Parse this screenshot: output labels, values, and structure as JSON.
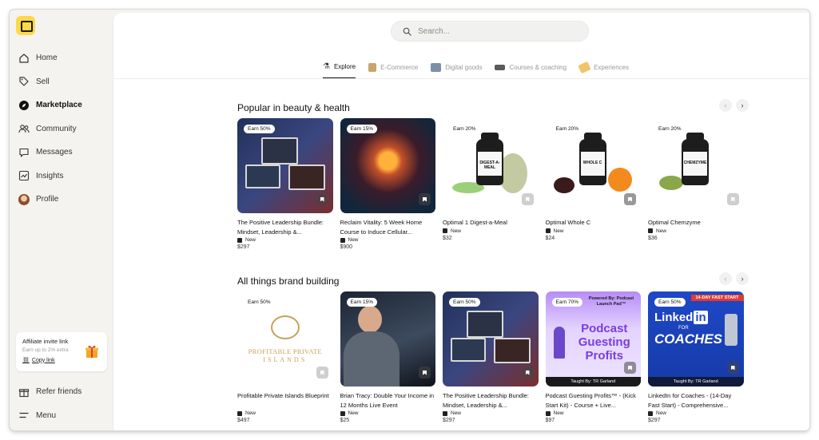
{
  "sidebar": {
    "items": [
      {
        "label": "Home",
        "icon": "home-icon"
      },
      {
        "label": "Sell",
        "icon": "tag-icon"
      },
      {
        "label": "Marketplace",
        "icon": "compass-icon",
        "active": true
      },
      {
        "label": "Community",
        "icon": "people-icon"
      },
      {
        "label": "Messages",
        "icon": "chat-icon"
      },
      {
        "label": "Insights",
        "icon": "chart-icon"
      },
      {
        "label": "Profile",
        "icon": "avatar"
      }
    ],
    "affiliate": {
      "title": "Affiliate invite link",
      "subtitle": "Earn up to 2% extra",
      "link": "Copy link"
    },
    "bottom": [
      {
        "label": "Refer friends",
        "icon": "gift-icon"
      },
      {
        "label": "Menu",
        "icon": "menu-icon"
      }
    ]
  },
  "search": {
    "placeholder": "Search..."
  },
  "tabs": [
    {
      "label": "Explore",
      "active": true
    },
    {
      "label": "E-Commerce"
    },
    {
      "label": "Digital goods"
    },
    {
      "label": "Courses & coaching"
    },
    {
      "label": "Experiences"
    }
  ],
  "sections": [
    {
      "title": "Popular in beauty & health",
      "cards": [
        {
          "earn": "Earn 50%",
          "title": "The Positive Leadership Bundle: Mindset, Leadership &...",
          "badge": "New",
          "price": "$297"
        },
        {
          "earn": "Earn 15%",
          "title": "Reclaim Vitality: 5 Week Home Course to Induce Cellular...",
          "badge": "New",
          "price": "$900"
        },
        {
          "earn": "Earn 20%",
          "title": "Optimal 1 Digest-a-Meal",
          "badge": "New",
          "price": "$32",
          "bottle_label": "DIGEST-A-MEAL"
        },
        {
          "earn": "Earn 20%",
          "title": "Optimal Whole C",
          "badge": "New",
          "price": "$24",
          "bottle_label": "WHOLE C"
        },
        {
          "earn": "Earn 20%",
          "title": "Optimal Chemzyme",
          "badge": "New",
          "price": "$36",
          "bottle_label": "CHEMZYME"
        }
      ]
    },
    {
      "title": "All things brand building",
      "cards": [
        {
          "earn": "Earn 50%",
          "title": "Profitable Private Islands Blueprint",
          "badge": "New",
          "price": "$497",
          "art_text": "PROFITABLE PRIVATE",
          "art_text2": "ISLANDS"
        },
        {
          "earn": "Earn 15%",
          "title": "Brian Tracy: Double Your Income in 12 Months Live Event",
          "badge": "New",
          "price": "$25"
        },
        {
          "earn": "Earn 50%",
          "title": "The Positive Leadership Bundle: Mindset, Leadership &...",
          "badge": "New",
          "price": "$297"
        },
        {
          "earn": "Earn 70%",
          "title": "Podcast Guesting Profits™ - (Kick Start Kit) - Course + Live...",
          "badge": "New",
          "price": "$97",
          "art_top": "Powered By: Podcast Launch Pad™",
          "art_text": "Podcast Guesting Profits",
          "art_bottom": "Taught By: TR Garland"
        },
        {
          "earn": "Earn 50%",
          "title": "LinkedIn for Coaches - (14-Day Fast Start) - Comprehensive...",
          "badge": "New",
          "price": "$297",
          "art_ribbon": "14-DAY FAST START",
          "art_text": "Linked",
          "art_in": "in",
          "art_for": "FOR",
          "art_text2": "COACHES",
          "art_bottom": "Taught By: TR Garland"
        }
      ]
    }
  ],
  "colors": {
    "accent": "#ffd84a",
    "sidebar_bg": "#f4f3ef"
  }
}
